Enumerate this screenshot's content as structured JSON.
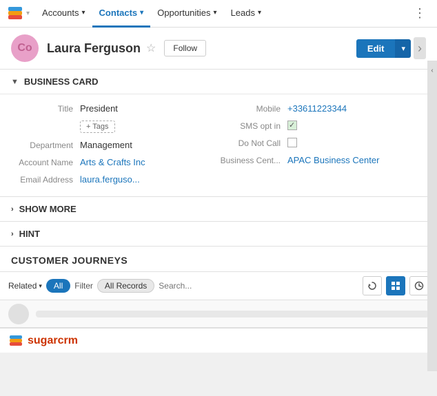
{
  "nav": {
    "items": [
      {
        "label": "Accounts",
        "active": false
      },
      {
        "label": "Contacts",
        "active": true
      },
      {
        "label": "Opportunities",
        "active": false
      },
      {
        "label": "Leads",
        "active": false
      }
    ],
    "more_icon": "⋮"
  },
  "header": {
    "avatar_initials": "Co",
    "contact_name": "Laura Ferguson",
    "follow_label": "Follow",
    "edit_label": "Edit",
    "star": "☆"
  },
  "business_card": {
    "section_title": "BUSINESS CARD",
    "fields_left": [
      {
        "label": "Title",
        "value": "President",
        "type": "text"
      },
      {
        "label": "",
        "value": "+ Tags",
        "type": "tags"
      },
      {
        "label": "Department",
        "value": "Management",
        "type": "text"
      },
      {
        "label": "Account Name",
        "value": "Arts & Crafts Inc",
        "type": "link"
      },
      {
        "label": "Email Address",
        "value": "laura.ferguso...",
        "type": "link"
      }
    ],
    "fields_right": [
      {
        "label": "Mobile",
        "value": "+33611223344",
        "type": "link"
      },
      {
        "label": "SMS opt in",
        "value": "",
        "type": "checkbox_checked"
      },
      {
        "label": "Do Not Call",
        "value": "",
        "type": "checkbox_empty"
      },
      {
        "label": "Business Cent...",
        "value": "APAC Business Center",
        "type": "link"
      }
    ]
  },
  "show_more": {
    "label": "SHOW MORE"
  },
  "hint": {
    "label": "HINT"
  },
  "customer_journeys": {
    "title": "CUSTOMER JOURNEYS",
    "filter_bar": {
      "related_label": "Related",
      "all_pill": "All",
      "filter_label": "Filter",
      "all_records_pill": "All Records",
      "search_placeholder": "Search..."
    }
  },
  "footer": {
    "logo_text": "sugarcrm"
  }
}
